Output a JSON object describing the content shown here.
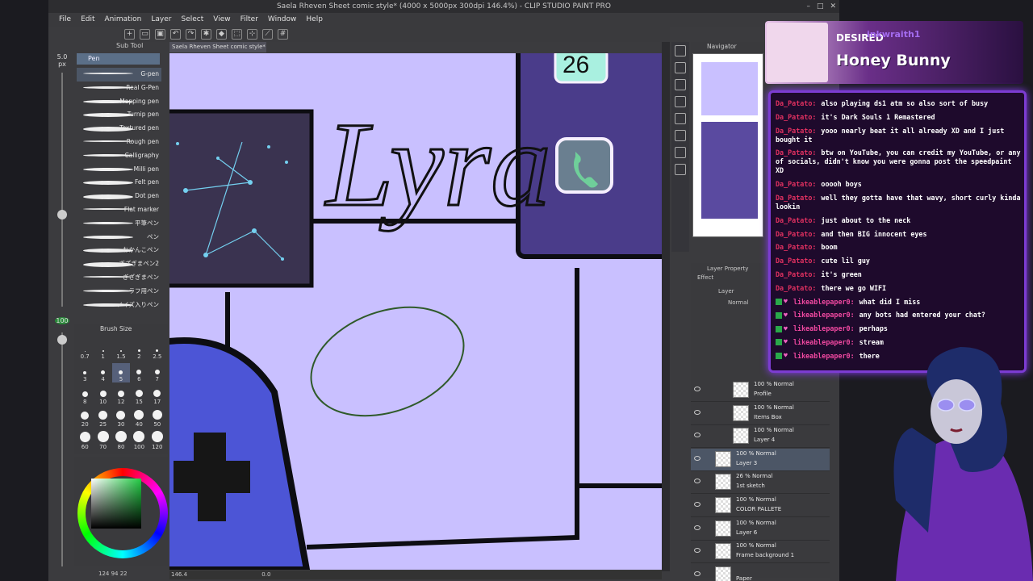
{
  "window": {
    "title": "Saela Rheven Sheet comic style* (4000 x 5000px 300dpi 146.4%) - CLIP STUDIO PAINT PRO"
  },
  "menu": [
    "File",
    "Edit",
    "Animation",
    "Layer",
    "Select",
    "View",
    "Filter",
    "Window",
    "Help"
  ],
  "left_sidebar": {
    "brush_size_value": "5.0",
    "brush_size_unit": "px",
    "opacity_value": "100"
  },
  "subtool": {
    "tab_label": "Sub Tool",
    "group_label": "Pen",
    "brushes": [
      {
        "label": "G-pen",
        "selected": true
      },
      {
        "label": "Real G-Pen",
        "selected": false
      },
      {
        "label": "Mapping pen",
        "selected": false
      },
      {
        "label": "Turnip pen",
        "selected": false
      },
      {
        "label": "Textured pen",
        "selected": false
      },
      {
        "label": "Rough pen",
        "selected": false
      },
      {
        "label": "Calligraphy",
        "selected": false
      },
      {
        "label": "Milli pen",
        "selected": false
      },
      {
        "label": "Felt pen",
        "selected": false
      },
      {
        "label": "Dot pen",
        "selected": false
      },
      {
        "label": "Flat marker",
        "selected": false
      },
      {
        "label": "平筆ペン",
        "selected": false
      },
      {
        "label": "ペン",
        "selected": false
      },
      {
        "label": "おかんこペン",
        "selected": false
      },
      {
        "label": "ぎざぎまペン2",
        "selected": false
      },
      {
        "label": "ぎざぎまペン",
        "selected": false
      },
      {
        "label": "ラフ用ペン",
        "selected": false
      },
      {
        "label": "ノイズ入りペン",
        "selected": false
      }
    ]
  },
  "brush_size": {
    "title": "Brush Size",
    "sizes": [
      "0.7",
      "1",
      "1.5",
      "2",
      "2.5",
      "3",
      "4",
      "5",
      "6",
      "7",
      "8",
      "10",
      "12",
      "15",
      "17",
      "20",
      "25",
      "30",
      "40",
      "50",
      "60",
      "70",
      "80",
      "100",
      "120"
    ],
    "selected": "5"
  },
  "status": {
    "left": "124 94 22",
    "canvas": "146.4",
    "angle": "0.0"
  },
  "document_tab": "Saela Rheven Sheet comic style*",
  "canvas": {
    "lettering": "Lyra",
    "number_badge": "26"
  },
  "navigator": {
    "title": "Navigator"
  },
  "layer_panel": {
    "tabs": "Layer Property",
    "effect_label": "Effect",
    "tab2": "Layer",
    "blend": "Normal",
    "layers": [
      {
        "l1": "100 % Normal",
        "l2": "Profile",
        "selected": false
      },
      {
        "l1": "100 % Normal",
        "l2": "Items Box",
        "selected": false
      },
      {
        "l1": "100 % Normal",
        "l2": "Layer 4",
        "selected": false
      },
      {
        "l1": "100 % Normal",
        "l2": "Layer 3",
        "selected": true
      },
      {
        "l1": "26 % Normal",
        "l2": "1st sketch",
        "selected": false
      },
      {
        "l1": "100 % Normal",
        "l2": "COLOR PALLETE",
        "selected": false
      },
      {
        "l1": "100 % Normal",
        "l2": "Layer 6",
        "selected": false
      },
      {
        "l1": "100 % Normal",
        "l2": "Frame background 1",
        "selected": false
      },
      {
        "l1": "",
        "l2": "Paper",
        "selected": false
      }
    ]
  },
  "stream": {
    "desired_label": "DESIRED",
    "desired_user": "inkwraith1",
    "desired_name": "Honey Bunny",
    "chat": [
      {
        "user": "Da_Patato:",
        "text": "also playing ds1 atm so also sort of busy",
        "badges": false
      },
      {
        "user": "Da_Patato:",
        "text": "it's Dark Souls 1 Remastered",
        "badges": false
      },
      {
        "user": "Da_Patato:",
        "text": "yooo nearly beat it all already XD and I just bought it",
        "badges": false
      },
      {
        "user": "Da_Patato:",
        "text": "btw on YouTube, you can credit my YouTube, or any of socials, didn't know you were gonna post the speedpaint XD",
        "badges": false
      },
      {
        "user": "Da_Patato:",
        "text": "ooooh boys",
        "badges": false
      },
      {
        "user": "Da_Patato:",
        "text": "well they gotta have that wavy, short curly kinda lookin",
        "badges": false
      },
      {
        "user": "Da_Patato:",
        "text": "just about to the neck",
        "badges": false
      },
      {
        "user": "Da_Patato:",
        "text": "and then BIG innocent eyes",
        "badges": false
      },
      {
        "user": "Da_Patato:",
        "text": "boom",
        "badges": false
      },
      {
        "user": "Da_Patato:",
        "text": "cute lil guy",
        "badges": false
      },
      {
        "user": "Da_Patato:",
        "text": "it's green",
        "badges": false
      },
      {
        "user": "Da_Patato:",
        "text": "there we go WIFI",
        "badges": false
      },
      {
        "user": "likeablepaper0:",
        "text": "what did I miss",
        "badges": true
      },
      {
        "user": "likeablepaper0:",
        "text": "any bots had entered your chat?",
        "badges": true
      },
      {
        "user": "likeablepaper0:",
        "text": "perhaps",
        "badges": true
      },
      {
        "user": "likeablepaper0:",
        "text": "stream",
        "badges": true
      },
      {
        "user": "likeablepaper0:",
        "text": "there",
        "badges": true
      }
    ]
  },
  "colors": {
    "canvas_bg": "#c9c0ff",
    "selection": "#4c5666",
    "chat_border": "#7c3cd2",
    "chat_user": "#e03060"
  }
}
